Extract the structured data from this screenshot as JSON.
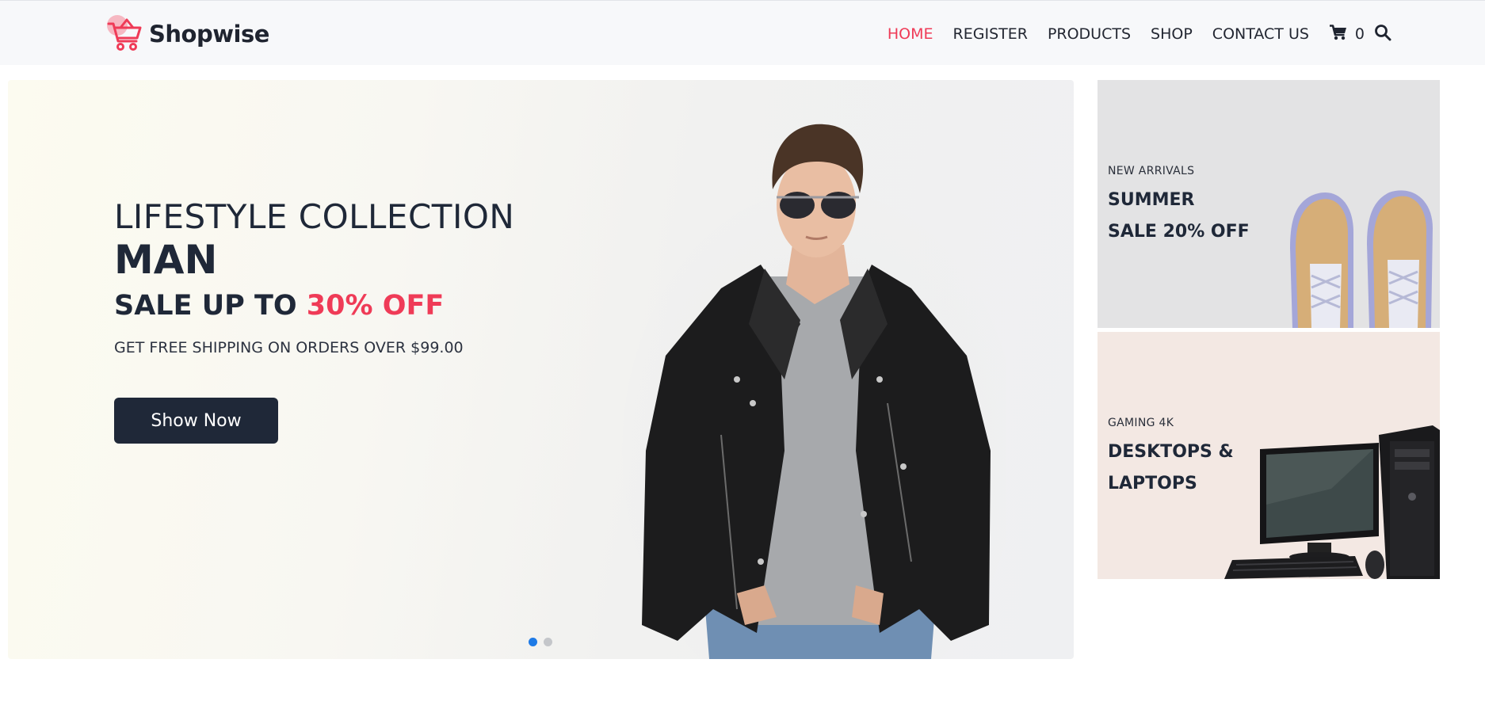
{
  "brand": {
    "name": "Shopwise",
    "accent_color": "#ef3b57",
    "dark_color": "#1f2838"
  },
  "nav": {
    "items": [
      {
        "label": "HOME",
        "active": true
      },
      {
        "label": "REGISTER",
        "active": false
      },
      {
        "label": "PRODUCTS",
        "active": false
      },
      {
        "label": "SHOP",
        "active": false
      },
      {
        "label": "CONTACT US",
        "active": false
      }
    ],
    "cart_icon": "cart-icon",
    "cart_count": "0",
    "search_icon": "search-icon"
  },
  "hero": {
    "line1": "LIFESTYLE COLLECTION",
    "line2": "MAN",
    "line3_prefix": "SALE UP TO ",
    "line3_accent": "30% OFF",
    "line4": "GET FREE SHIPPING ON ORDERS OVER $99.00",
    "button_label": "Show Now",
    "slides": [
      {
        "active": true
      },
      {
        "active": false
      }
    ]
  },
  "banners": [
    {
      "kicker": "NEW ARRIVALS",
      "title_line1": "SUMMER",
      "title_line2": "SALE 20% OFF"
    },
    {
      "kicker": "GAMING 4K",
      "title_line1": "DESKTOPS &",
      "title_line2": "LAPTOPS"
    }
  ]
}
